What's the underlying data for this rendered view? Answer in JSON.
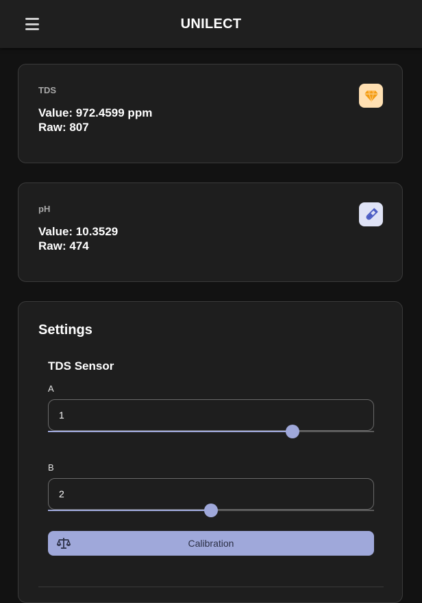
{
  "appbar": {
    "title": "UNILECT",
    "menu_icon": "hamburger-menu-icon"
  },
  "sensors": [
    {
      "label": "TDS",
      "value_text": "Value: 972.4599 ppm",
      "raw_text": "Raw: 807",
      "icon": "diamond-icon",
      "icon_bg": "#ffe0b2",
      "icon_color": "#f39c12"
    },
    {
      "label": "pH",
      "value_text": "Value: 10.3529",
      "raw_text": "Raw: 474",
      "icon": "test-tube-icon",
      "icon_bg": "#dfe3f6",
      "icon_color": "#4a5cc4"
    }
  ],
  "settings": {
    "title": "Settings",
    "section_title": "TDS Sensor",
    "fields": [
      {
        "label": "A",
        "value": "1",
        "slider_fraction": 0.75
      },
      {
        "label": "B",
        "value": "2",
        "slider_fraction": 0.5
      }
    ],
    "calibration_button": {
      "label": "Calibration",
      "icon": "scale-balance-icon"
    }
  },
  "colors": {
    "background": "#121212",
    "surface": "#1e1e1e",
    "accent": "#9fa8da"
  }
}
